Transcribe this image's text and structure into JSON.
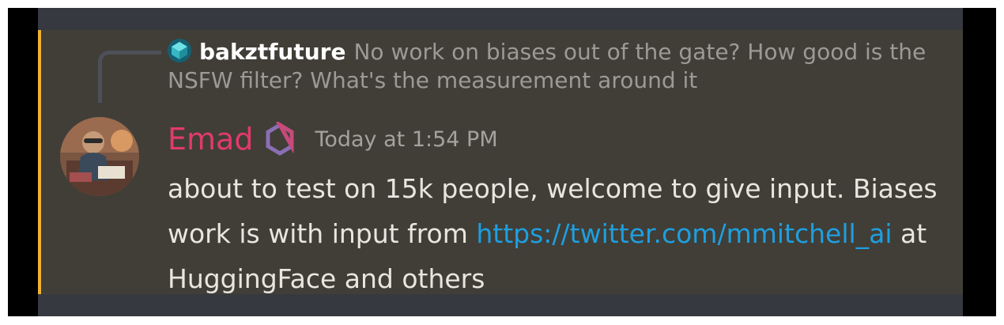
{
  "reply": {
    "username": "bakztfuture",
    "text": "No work on biases out of the gate?  How good is the NSFW filter?  What's the measurement around it",
    "avatar_icon": "teal-cube-avatar-icon"
  },
  "message": {
    "author": "Emad",
    "author_color": "#e23a6b",
    "role_icon": "hexagon-ring-icon",
    "timestamp": "Today at 1:54 PM",
    "text_before_link": "about to test on 15k people, welcome to give input. Biases work is with input from ",
    "link": "https://twitter.com/mmitchell_ai",
    "text_after_link": " at HuggingFace and others"
  },
  "colors": {
    "mention_highlight_bar": "#f0b232",
    "mention_background": "#403e37",
    "link": "#1e9fe0"
  }
}
